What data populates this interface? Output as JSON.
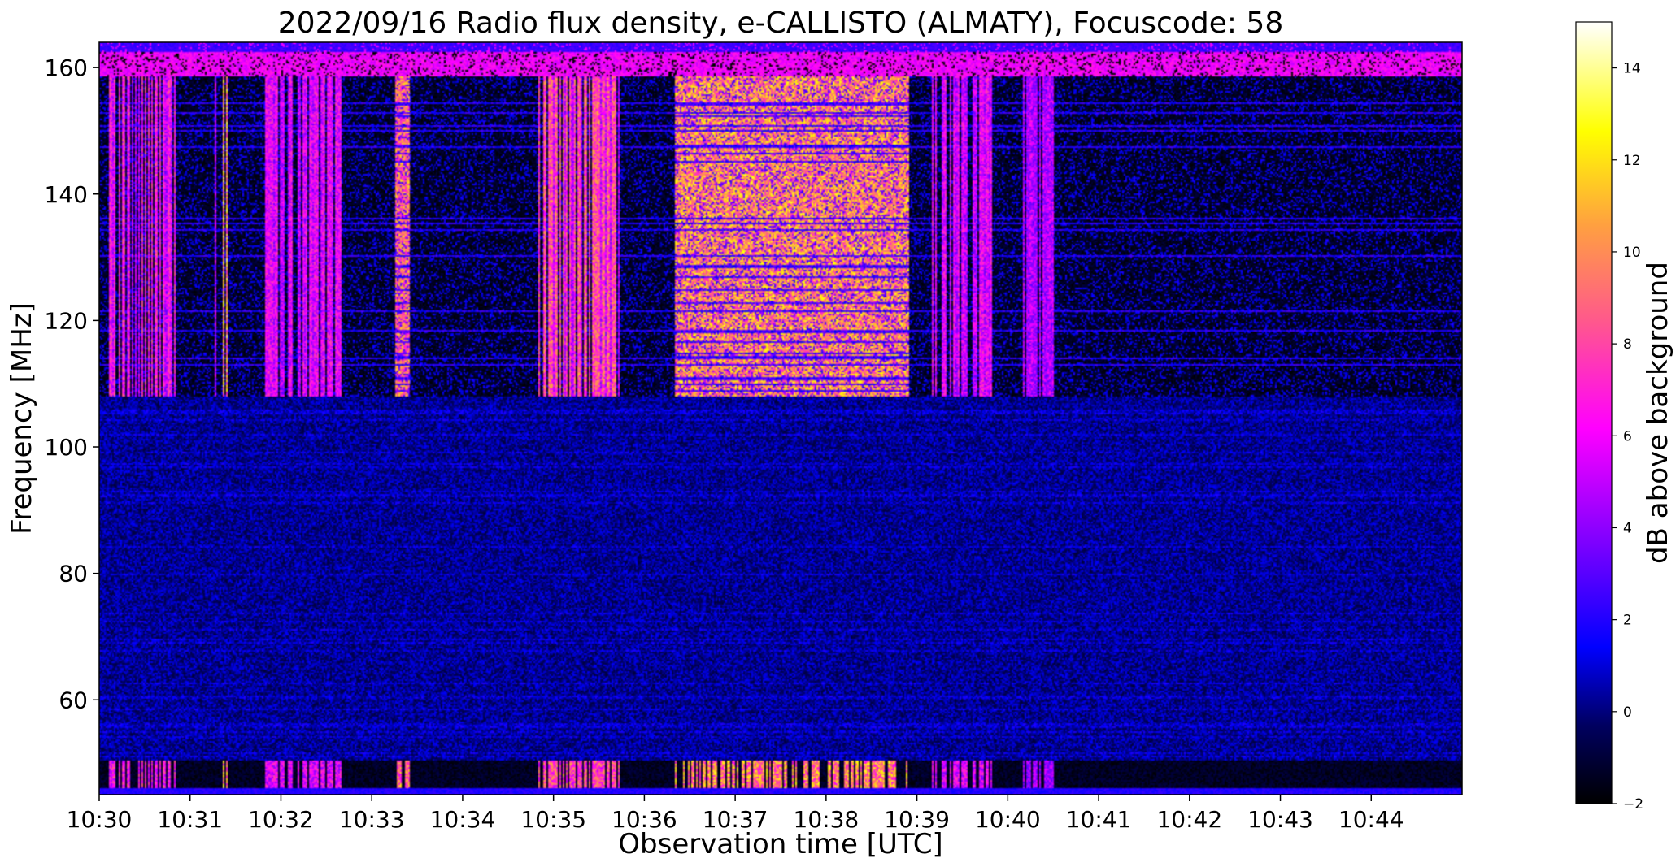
{
  "chart_data": {
    "type": "heatmap",
    "title": "2022/09/16  Radio flux density, e-CALLISTO (ALMATY), Focuscode: 58",
    "xlabel": "Observation time [UTC]",
    "ylabel": "Frequency [MHz]",
    "x_unit": "minutes",
    "xlim": [
      "10:30",
      "10:45"
    ],
    "ylim": [
      45,
      164
    ],
    "x_ticks": [
      "10:30",
      "10:31",
      "10:32",
      "10:33",
      "10:34",
      "10:35",
      "10:36",
      "10:37",
      "10:38",
      "10:39",
      "10:40",
      "10:41",
      "10:42",
      "10:43",
      "10:44"
    ],
    "y_ticks": [
      60,
      80,
      100,
      120,
      140,
      160
    ],
    "colorbar": {
      "label": "dB above background",
      "range": [
        -2,
        15
      ],
      "ticks": [
        -2,
        0,
        2,
        4,
        6,
        8,
        10,
        12,
        14
      ],
      "colormap": "gnuplot2",
      "stops": [
        "#000000",
        "#0000ff",
        "#ff00ff",
        "#ffa040",
        "#ffff00",
        "#ffffff"
      ]
    },
    "upper_band_MHz": [
      108,
      164
    ],
    "lower_band_MHz": [
      45,
      108
    ],
    "bursts": [
      {
        "start": "10:30:05",
        "end": "10:30:50",
        "peak_dB": 9
      },
      {
        "start": "10:31:15",
        "end": "10:31:25",
        "peak_dB": 14
      },
      {
        "start": "10:31:50",
        "end": "10:32:40",
        "peak_dB": 8
      },
      {
        "start": "10:33:15",
        "end": "10:33:25",
        "peak_dB": 12
      },
      {
        "start": "10:34:50",
        "end": "10:35:45",
        "peak_dB": 11
      },
      {
        "start": "10:36:20",
        "end": "10:38:55",
        "peak_dB": 13
      },
      {
        "start": "10:39:10",
        "end": "10:39:50",
        "peak_dB": 8
      },
      {
        "start": "10:40:10",
        "end": "10:40:30",
        "peak_dB": 6
      }
    ]
  }
}
